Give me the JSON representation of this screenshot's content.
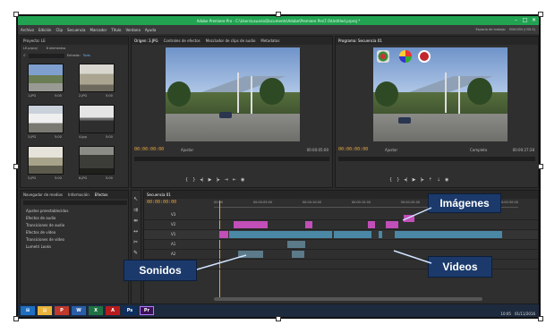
{
  "window": {
    "title": "Adobe Premiere Pro - C:\\Users\\usuario\\Documents\\Adobe\\Premiere Pro\\7.0\\Untitled.prproj *"
  },
  "menu": [
    "Archivo",
    "Edición",
    "Clip",
    "Secuencia",
    "Marcador",
    "Título",
    "Ventana",
    "Ayuda"
  ],
  "workspace": {
    "left": "Espacio de trabajo:",
    "value": "EDICIÓN (CS5.5)"
  },
  "project_panel": {
    "tab": "Proyecto: LE",
    "name": "LE.prproj",
    "items_count": "6 elementos",
    "search_label": "Entrada:",
    "search_value": "Todo",
    "thumbs": [
      {
        "name": "1.JPG",
        "dur": "5:00"
      },
      {
        "name": "2.JPG",
        "dur": "5:00"
      },
      {
        "name": "3.JPG",
        "dur": "5:00"
      },
      {
        "name": "4.jpg",
        "dur": "5:00"
      },
      {
        "name": "5.JPG",
        "dur": "5:00"
      },
      {
        "name": "6.JPG",
        "dur": "5:00"
      }
    ]
  },
  "source_monitor": {
    "tabs": [
      "Origen: 3.JPG",
      "Controles de efectos",
      "Mezclador de clips de audio",
      "Metadatos"
    ],
    "timecode": "00:00:00:00",
    "fit": "Ajustar",
    "end": "00:00:05:00"
  },
  "program_monitor": {
    "tab": "Programa: Secuencia 01",
    "timecode": "00:00:00:00",
    "fit": "Ajustar",
    "quality": "Completo",
    "end": "00:00:27:28"
  },
  "effects_panel": {
    "tabs": [
      "Navegador de medios",
      "Información",
      "Efectos"
    ],
    "items": [
      "Ajustes preestablecidos",
      "Efectos de audio",
      "Transiciones de audio",
      "Efectos de vídeo",
      "Transiciones de vídeo",
      "Lumetri Looks"
    ]
  },
  "timeline": {
    "tab": "Secuencia 01",
    "timecode": "00:00:00:00",
    "ruler": [
      "00:00",
      "00:00:05:00",
      "00:00:10:00",
      "00:00:15:00",
      "00:00:20:00",
      "00:00:25:00",
      "00:00:30:00"
    ],
    "tracks": [
      "V3",
      "V2",
      "V1",
      "A1",
      "A2",
      "A3"
    ]
  },
  "annotations": {
    "imagenes": "Imágenes",
    "sonidos": "Sonidos",
    "videos": "Videos"
  },
  "taskbar": {
    "apps": [
      "Iniciar",
      "Explorador",
      "PowerPoint",
      "Word",
      "Excel",
      "Acrobat",
      "Photoshop",
      "Premiere"
    ],
    "time": "10:05",
    "date": "01/11/2016"
  },
  "colors": {
    "title_green": "#21a352",
    "note_blue": "#1b3a6b",
    "clip_pink": "#c14fb7",
    "clip_teal": "#4a88a6",
    "timecode": "#e8a640"
  }
}
